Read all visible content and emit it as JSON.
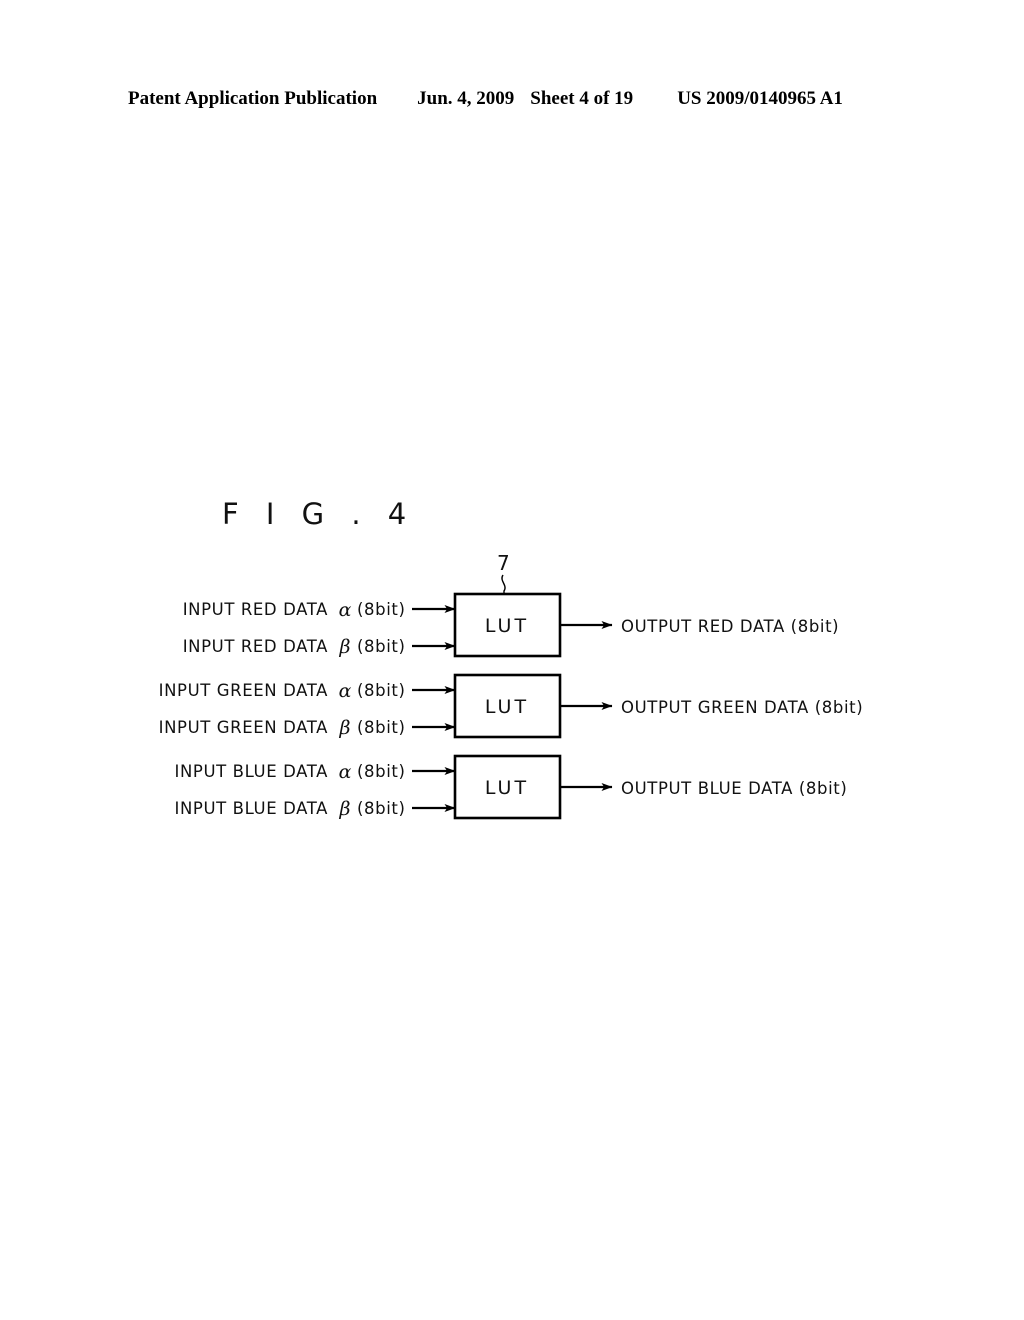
{
  "header": {
    "publication": "Patent Application Publication",
    "date": "Jun. 4, 2009",
    "sheet": "Sheet 4 of 19",
    "patent_number": "US 2009/0140965 A1"
  },
  "figure": {
    "title": "F I G . 4",
    "reference_numeral": "7",
    "block_label": "LUT",
    "rows": [
      {
        "channel": "RED",
        "input_alpha": "INPUT RED DATA",
        "input_alpha_symbol": "α",
        "input_alpha_bits": "(8bit)",
        "input_beta": "INPUT RED DATA",
        "input_beta_symbol": "β",
        "input_beta_bits": "(8bit)",
        "block": "LUT",
        "output": "OUTPUT RED DATA (8bit)"
      },
      {
        "channel": "GREEN",
        "input_alpha": "INPUT GREEN DATA",
        "input_alpha_symbol": "α",
        "input_alpha_bits": "(8bit)",
        "input_beta": "INPUT GREEN DATA",
        "input_beta_symbol": "β",
        "input_beta_bits": "(8bit)",
        "block": "LUT",
        "output": "OUTPUT GREEN DATA (8bit)"
      },
      {
        "channel": "BLUE",
        "input_alpha": "INPUT BLUE DATA",
        "input_alpha_symbol": "α",
        "input_alpha_bits": "(8bit)",
        "input_beta": "INPUT BLUE DATA",
        "input_beta_symbol": "β",
        "input_beta_bits": "(8bit)",
        "block": "LUT",
        "output": "OUTPUT BLUE DATA (8bit)"
      }
    ]
  },
  "colors": {
    "ink": "#000000",
    "paper": "#ffffff"
  }
}
